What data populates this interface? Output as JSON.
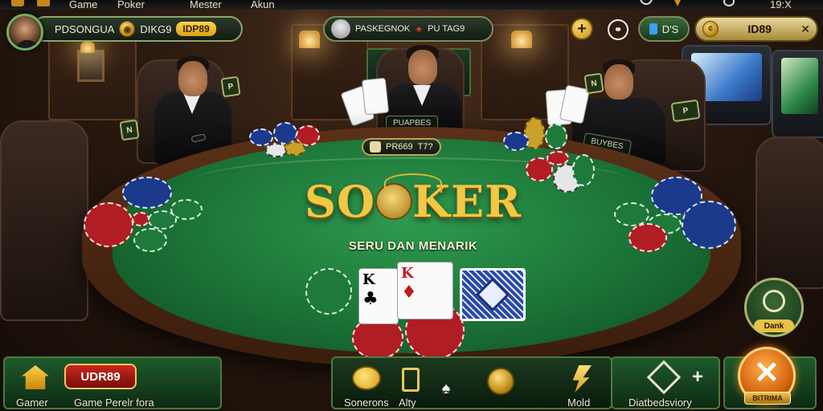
{
  "top_menu": {
    "items": [
      "Game",
      "Poker",
      "Mester",
      "Akun"
    ],
    "time": "19:X"
  },
  "player": {
    "name": "PDSONGUA",
    "coin_label": "DIKG9",
    "currency": "IDP89"
  },
  "table_host": {
    "name": "PASKEGNOK",
    "tag": "PU TAG9"
  },
  "header_right": {
    "plus_label": "+",
    "dollar_label": "D'S",
    "currency": "ID89",
    "star_label": "★"
  },
  "pot": {
    "label": "PR669",
    "value": "T7?"
  },
  "seats": {
    "left_name": "",
    "center_name": "PUAPBES",
    "right_name": "BUYBES"
  },
  "seat_badges": [
    "N",
    "P",
    "N",
    "P"
  ],
  "logo": {
    "text_left": "SO",
    "text_right": "KER",
    "tagline": "SERU DAN MENARIK"
  },
  "cards": {
    "hand": [
      {
        "rank": "K",
        "suit": "♣",
        "red": false
      },
      {
        "rank": "K",
        "suit": "♦",
        "red": true
      }
    ]
  },
  "side_button": {
    "label": "Dank"
  },
  "bottom_bar": {
    "home_label": "Gamer",
    "balance_badge": "UDR89",
    "game_label": "Game Perelr fora",
    "items": [
      {
        "label": "Sonerons",
        "icon": "chick-icon"
      },
      {
        "label": "Alty",
        "icon": "music-icon"
      },
      {
        "label": "",
        "icon": "spade-icon"
      },
      {
        "label": "",
        "icon": "coin-icon"
      },
      {
        "label": "Mold",
        "icon": "lightning-icon"
      },
      {
        "label": "Diatbedsviory",
        "icon": "diamond-icon"
      }
    ],
    "plus_label": "+",
    "main_action_label": "BITRIMA"
  },
  "colors": {
    "felt": "#1b7236",
    "gold": "#f2c744",
    "accent_red": "#c7281e",
    "panel_green": "#1e5a2a"
  }
}
